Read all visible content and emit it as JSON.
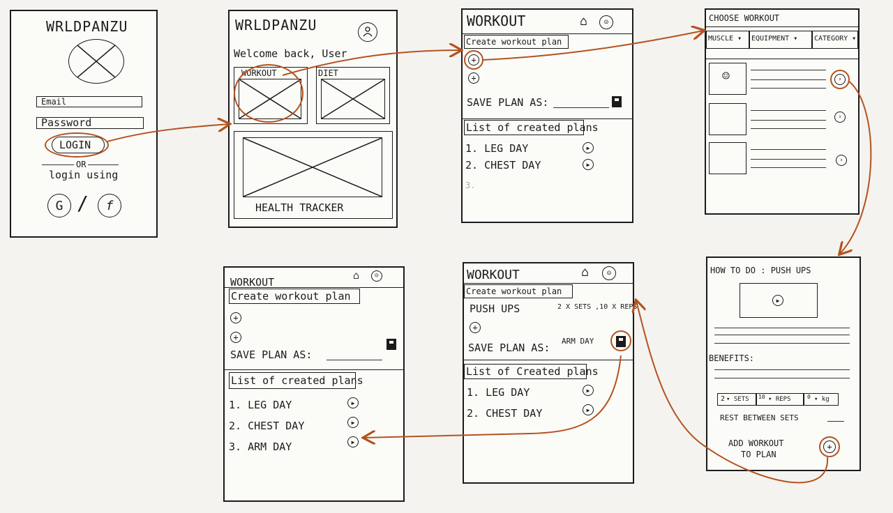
{
  "screens": {
    "login": {
      "brand": "WRLDPANZU",
      "email_label": "Email",
      "password_label": "Password",
      "login_button": "LOGIN",
      "or_text": "OR",
      "login_using": "login using",
      "google_glyph": "G",
      "facebook_glyph": "f",
      "icons": [
        "logo-placeholder-icon",
        "google-icon",
        "facebook-icon"
      ]
    },
    "home": {
      "brand": "WRLDPANZU",
      "welcome": "Welcome back, User",
      "workout_tile": "WORKOUT",
      "diet_tile": "DIET",
      "health_tile": "HEALTH TRACKER",
      "icons": [
        "profile-icon"
      ]
    },
    "workout_empty": {
      "title": "WORKOUT",
      "create_plan": "Create workout plan",
      "save_plan_as": "SAVE PLAN AS:",
      "list_header": "List of created plans",
      "plans": [
        "1. LEG DAY",
        "2. CHEST DAY",
        "3."
      ],
      "icons": [
        "home-icon",
        "profile-icon",
        "add-icon",
        "save-icon",
        "play-icon"
      ]
    },
    "choose_workout": {
      "title": "CHOOSE WORKOUT",
      "filters": [
        "MUSCLE ▾",
        "EQUIPMENT ▾",
        "CATEGORY ▾"
      ],
      "icons": [
        "exercise-figure-icon",
        "arrow-right-icon"
      ]
    },
    "how_to": {
      "title": "HOW TO DO : PUSH UPS",
      "benefits_label": "BENEFITS:",
      "sets_value": "2",
      "sets_label": "▾ SETS",
      "reps_value": "10",
      "reps_label": "▾ REPS",
      "kg_value": "0",
      "kg_label": "▾ kg",
      "rest_label": "REST BETWEEN SETS",
      "add_to_plan": "ADD WORKOUT",
      "add_to_plan_2": "TO PLAN",
      "icons": [
        "play-icon",
        "add-icon"
      ]
    },
    "workout_filled": {
      "title": "WORKOUT",
      "create_plan": "Create workout plan",
      "exercise_name": "PUSH UPS",
      "exercise_detail": "2 X SETS ,10 X REPS",
      "save_plan_as": "SAVE PLAN AS:",
      "plan_name": "ARM DAY",
      "list_header": "List of Created plans",
      "plans": [
        "1. LEG DAY",
        "2. CHEST DAY"
      ],
      "icons": [
        "home-icon",
        "profile-icon",
        "add-icon",
        "save-icon",
        "play-icon"
      ]
    },
    "workout_final": {
      "title": "WORKOUT",
      "create_plan": "Create workout plan",
      "save_plan_as": "SAVE PLAN AS:",
      "list_header": "List of created plans",
      "plans": [
        "1. LEG DAY",
        "2. CHEST DAY",
        "3. ARM DAY"
      ],
      "icons": [
        "home-icon",
        "profile-icon",
        "add-icon",
        "save-icon",
        "play-icon"
      ]
    }
  },
  "colors": {
    "ink": "#1b1b1b",
    "accent": "#b4521f",
    "paper": "#fbfbf8"
  }
}
